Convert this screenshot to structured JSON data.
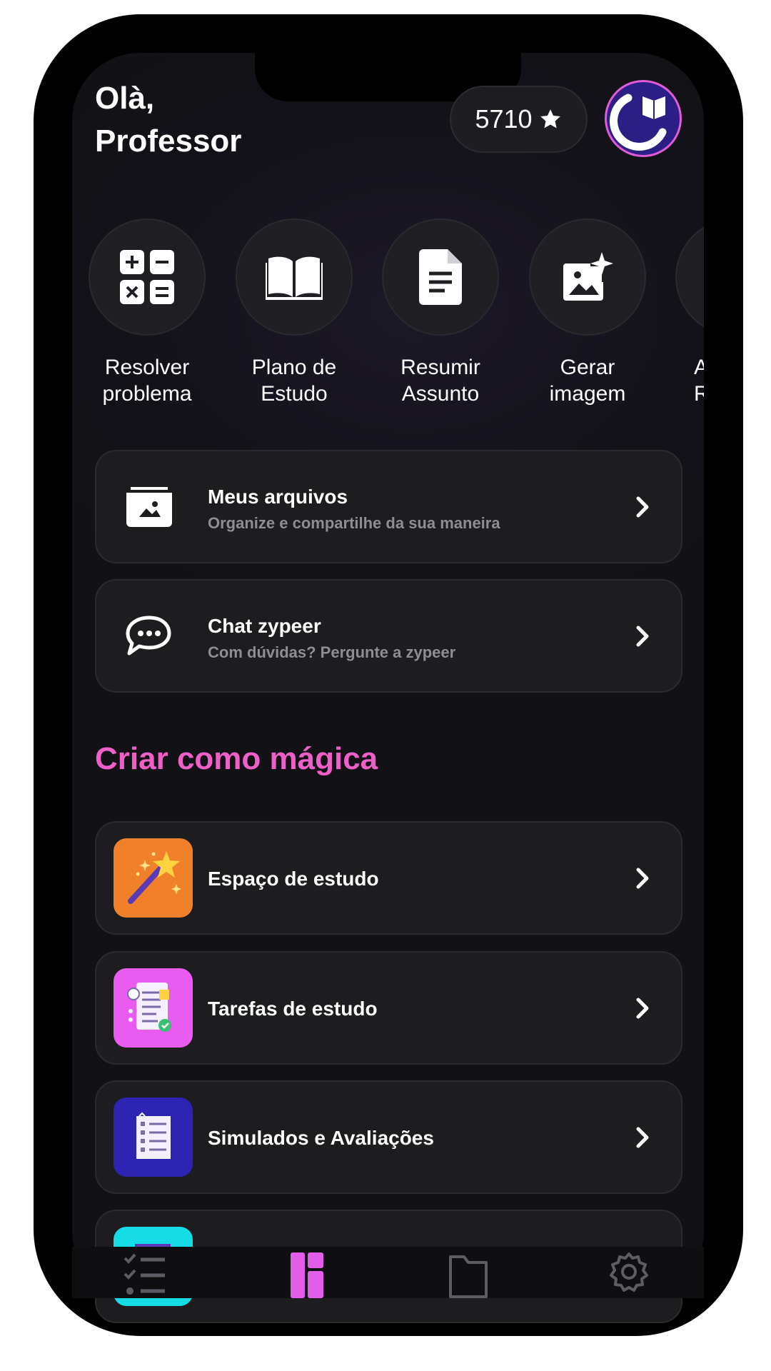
{
  "header": {
    "greeting_line1": "Olà,",
    "greeting_line2": "Professor",
    "credits": "5710",
    "credits_icon": "star-icon",
    "avatar_icon": "book-logo-icon"
  },
  "quick_actions": [
    {
      "label": "Resolver\nproblema",
      "icon": "calculator-icon"
    },
    {
      "label": "Plano de\nEstudo",
      "icon": "book-open-icon"
    },
    {
      "label": "Resumir\nAssunto",
      "icon": "document-icon"
    },
    {
      "label": "Gerar\nimagem",
      "icon": "image-sparkle-icon"
    },
    {
      "label": "A\nR",
      "icon": "partial-icon"
    }
  ],
  "cards": [
    {
      "title": "Meus arquivos",
      "subtitle": "Organize e compartilhe da sua maneira",
      "icon": "folder-image-icon"
    },
    {
      "title": "Chat zypeer",
      "subtitle": "Com dúvidas? Pergunte a zypeer",
      "icon": "chat-bubble-icon"
    }
  ],
  "magic": {
    "title": "Criar como mágica",
    "items": [
      {
        "title": "Espaço de estudo",
        "icon": "magic-wand-icon",
        "color": "#f0802a"
      },
      {
        "title": "Tarefas de estudo",
        "icon": "task-list-icon",
        "color": "#ea5cf0"
      },
      {
        "title": "Simulados e Avaliações",
        "icon": "checklist-icon",
        "color": "#2e24b3"
      },
      {
        "title": "",
        "icon": "form-icon",
        "color": "#16dde5"
      }
    ]
  },
  "bottom_nav": [
    {
      "icon": "tasks-icon",
      "active": false
    },
    {
      "icon": "dashboard-icon",
      "active": true
    },
    {
      "icon": "folder-icon",
      "active": false
    },
    {
      "icon": "gear-icon",
      "active": false
    }
  ],
  "colors": {
    "accent": "#ee5fc7",
    "active_nav": "#e35ee8"
  }
}
